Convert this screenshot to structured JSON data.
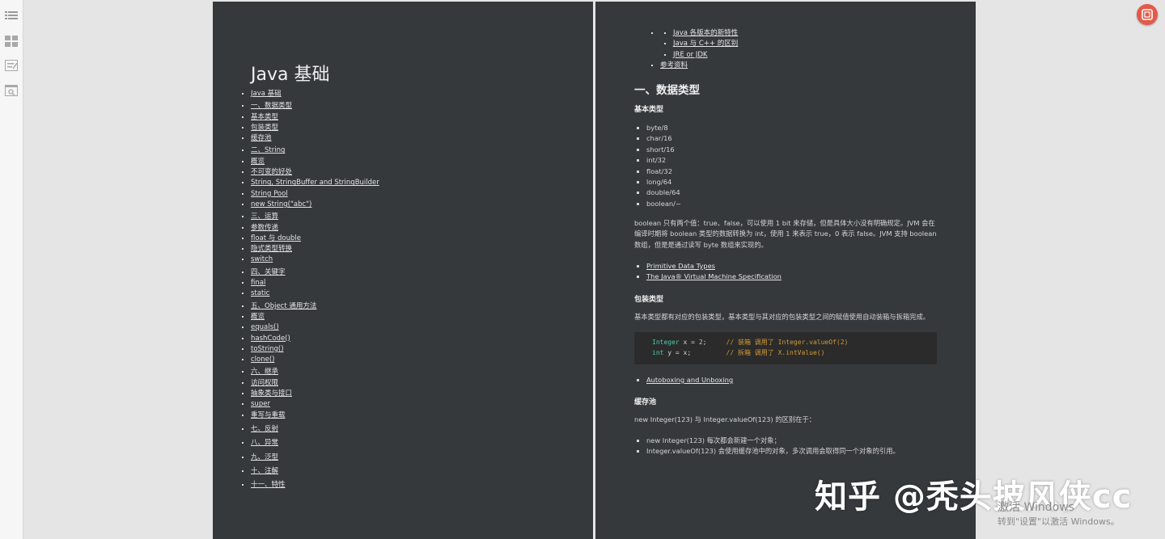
{
  "colors": {
    "page_bg": "#36393c",
    "viewer_bg": "#e5e5e5",
    "code_bg": "#2b2b2b",
    "code_keyword": "#4ec9b0",
    "code_number": "#b5cea8",
    "code_comment": "#d19a37",
    "accent_button": "#e25a4a"
  },
  "sidebar": {
    "icons": [
      "outline-list-icon",
      "thumbnails-grid-icon",
      "annotations-icon",
      "search-panel-icon"
    ]
  },
  "left_page": {
    "title": "Java 基础",
    "toc": {
      "root": "Java 基础",
      "sections": [
        {
          "label": "一、数据类型",
          "items": [
            "基本类型",
            "包装类型",
            "缓存池"
          ]
        },
        {
          "label": "二、String",
          "items": [
            "概览",
            "不可变的好处",
            "String, StringBuffer and StringBuilder",
            "String Pool",
            "new String(\"abc\")"
          ]
        },
        {
          "label": "三、运算",
          "items": [
            "参数传递",
            "float 与 double",
            "隐式类型转换",
            "switch"
          ]
        },
        {
          "label": "四、关键字",
          "items": [
            "final",
            "static"
          ]
        },
        {
          "label": "五、Object 通用方法",
          "items": [
            "概览",
            "equals()",
            "hashCode()",
            "toString()",
            "clone()"
          ]
        },
        {
          "label": "六、继承",
          "items": [
            "访问权限",
            "抽象类与接口",
            "super",
            "重写与重载"
          ]
        },
        {
          "label": "七、反射",
          "items": []
        },
        {
          "label": "八、异常",
          "items": []
        },
        {
          "label": "九、泛型",
          "items": []
        },
        {
          "label": "十、注解",
          "items": []
        },
        {
          "label": "十一、特性",
          "items": []
        }
      ]
    }
  },
  "right_page": {
    "toc_tail": {
      "items": [
        "Java 各版本的新特性",
        "Java 与 C++ 的区别",
        "JRE or JDK"
      ],
      "reference": "参考资料"
    },
    "h2_data_types": "一、数据类型",
    "h3_basic": "基本类型",
    "basic_types": [
      "byte/8",
      "char/16",
      "short/16",
      "int/32",
      "float/32",
      "long/64",
      "double/64",
      "boolean/~"
    ],
    "boolean_para": "boolean 只有两个值：true、false，可以使用 1 bit 来存储，但是具体大小没有明确规定。JVM 会在编译时期将 boolean 类型的数据转换为 int，使用 1 来表示 true，0 表示 false。JVM 支持 boolean 数组，但是是通过读写 byte 数组来实现的。",
    "basic_links": [
      "Primitive Data Types",
      "The Java® Virtual Machine Specification"
    ],
    "h3_wrapper": "包装类型",
    "wrapper_para": "基本类型都有对应的包装类型，基本类型与其对应的包装类型之间的赋值使用自动装箱与拆箱完成。",
    "code": {
      "line1": {
        "type": "Integer",
        "assign": " x = ",
        "num": "2",
        "end": ";     ",
        "comment": "// 装箱 调用了 Integer.valueOf(2)"
      },
      "line2": {
        "type": "int",
        "assign": " y = x;         ",
        "comment": "// 拆箱 调用了 X.intValue()"
      }
    },
    "wrapper_links": [
      "Autoboxing and Unboxing"
    ],
    "h3_cache": "缓存池",
    "cache_para": "new Integer(123) 与 Integer.valueOf(123) 的区别在于：",
    "cache_items": [
      "new Integer(123) 每次都会新建一个对象；",
      "Integer.valueOf(123) 会使用缓存池中的对象，多次调用会取得同一个对象的引用。"
    ]
  },
  "watermark": "知乎 @秃头披风侠cc",
  "windows_activation": {
    "line1": "激活 Windows",
    "line2": "转到\"设置\"以激活 Windows。"
  }
}
